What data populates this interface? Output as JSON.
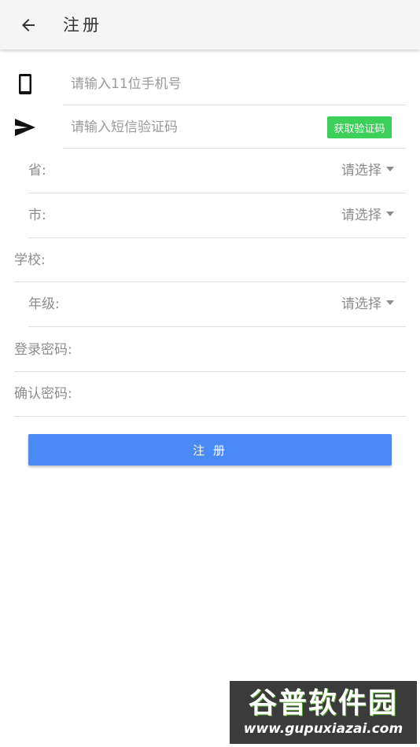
{
  "appbar": {
    "title": "注册",
    "back_icon": "arrow-left-icon"
  },
  "form": {
    "phone": {
      "icon": "smartphone-icon",
      "placeholder": "请输入11位手机号"
    },
    "sms": {
      "icon": "send-icon",
      "placeholder": "请输入短信验证码",
      "button_label": "获取验证码",
      "button_color": "#3ccf5a"
    },
    "province": {
      "label": "省:",
      "select_value": "请选择"
    },
    "city": {
      "label": "市:",
      "select_value": "请选择"
    },
    "school": {
      "label": "学校:"
    },
    "grade": {
      "label": "年级:",
      "select_value": "请选择"
    },
    "password": {
      "label": "登录密码:"
    },
    "confirm_password": {
      "label": "确认密码:"
    },
    "submit_label": "注 册",
    "submit_color": "#4a8af4"
  },
  "watermark": {
    "cn": "谷普软件园",
    "url": "www.gupuxiazai.com"
  }
}
